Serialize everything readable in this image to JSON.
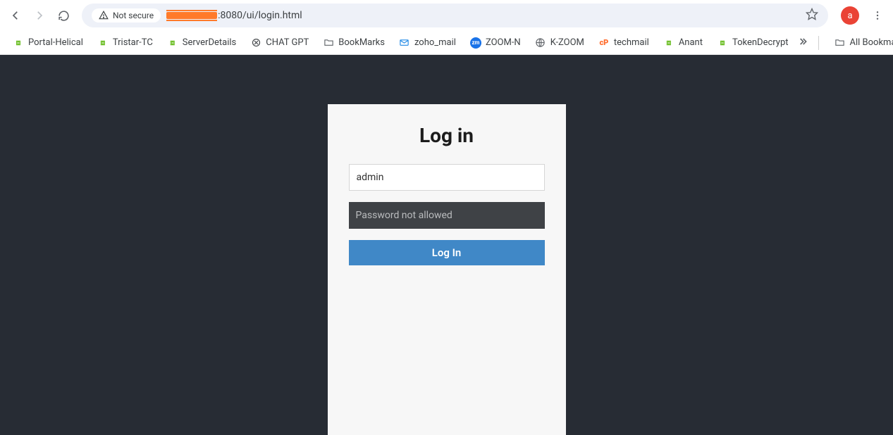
{
  "browser": {
    "security_label": "Not secure",
    "url_suffix": ":8080/ui/login.html",
    "profile_initial": "a"
  },
  "bookmarks": {
    "items": [
      {
        "label": "Portal-Helical"
      },
      {
        "label": "Tristar-TC"
      },
      {
        "label": "ServerDetails"
      },
      {
        "label": "CHAT GPT"
      },
      {
        "label": "BookMarks"
      },
      {
        "label": "zoho_mail"
      },
      {
        "label": "ZOOM-N"
      },
      {
        "label": "K-ZOOM"
      },
      {
        "label": "techmail"
      },
      {
        "label": "Anant"
      },
      {
        "label": "TokenDecrypt"
      }
    ],
    "all_label": "All Bookmarks"
  },
  "login": {
    "title": "Log in",
    "username_value": "admin",
    "password_msg": "Password not allowed",
    "button_label": "Log In"
  }
}
